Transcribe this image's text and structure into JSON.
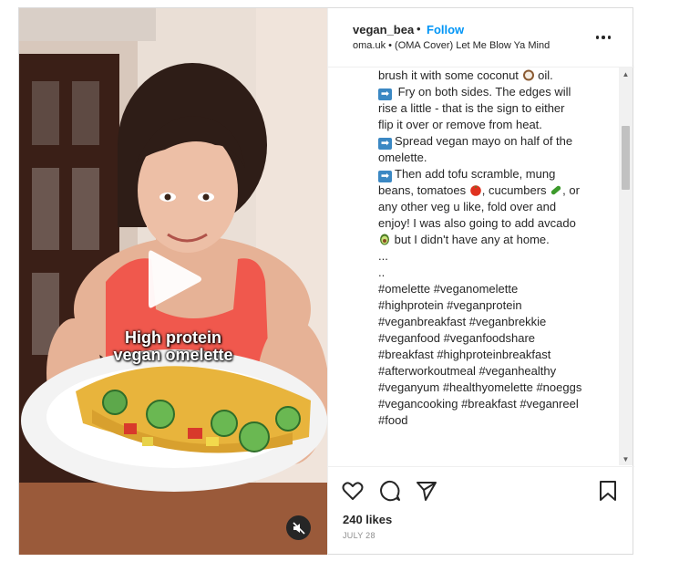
{
  "media": {
    "overlay_text": "High protein\nvegan omelette"
  },
  "header": {
    "username": "vegan_bea",
    "separator": "•",
    "follow_label": "Follow",
    "audio_text": "oma.uk • (OMA Cover) Let Me Blow Ya Mind"
  },
  "caption": {
    "lines": [
      {
        "pre": "",
        "text": "brush it with some coconut ",
        "emoji": "coconut-emoji",
        "post": " oil."
      },
      {
        "pre": "arrow",
        "text": " Fry on both sides. The edges will"
      },
      {
        "pre": "",
        "text": "rise a little - that is the sign to either"
      },
      {
        "pre": "",
        "text": "flip it over or remove from heat."
      },
      {
        "pre": "arrow",
        "text": "Spread vegan mayo on half of the"
      },
      {
        "pre": "",
        "text": "omelette."
      },
      {
        "pre": "arrow",
        "text": "Then add tofu scramble, mung"
      },
      {
        "pre": "",
        "text": "beans, tomatoes ",
        "emoji": "tomato-emoji",
        "post": ", cucumbers ",
        "emoji2": "cucumber-emoji",
        "post2": ", or"
      },
      {
        "pre": "",
        "text": "any other veg u like, fold over and"
      },
      {
        "pre": "",
        "text": "enjoy! I was also going to add avcado"
      },
      {
        "pre": "",
        "lead_emoji": "avocado-emoji",
        "text": " but I didn't have any at home."
      },
      {
        "pre": "",
        "text": "..."
      },
      {
        "pre": "",
        "text": ".."
      }
    ],
    "hashtag_lines": [
      "#omelette #veganomelette",
      "#highprotein #veganprotein",
      "#veganbreakfast #veganbrekkie",
      "#veganfood #veganfoodshare",
      "#breakfast #highproteinbreakfast",
      "#afterworkoutmeal #veganhealthy",
      "#veganyum #healthyomelette #noeggs",
      "#vegancooking #breakfast #veganreel",
      "#food"
    ]
  },
  "actions": {
    "icons": [
      "heart-icon",
      "comment-icon",
      "share-icon",
      "bookmark-icon"
    ],
    "likes": "240 likes",
    "date": "JULY 28"
  },
  "colors": {
    "accent": "#0095f6",
    "text": "#262626",
    "muted": "#8e8e8e",
    "arrow_emoji": "#3b88c3"
  }
}
